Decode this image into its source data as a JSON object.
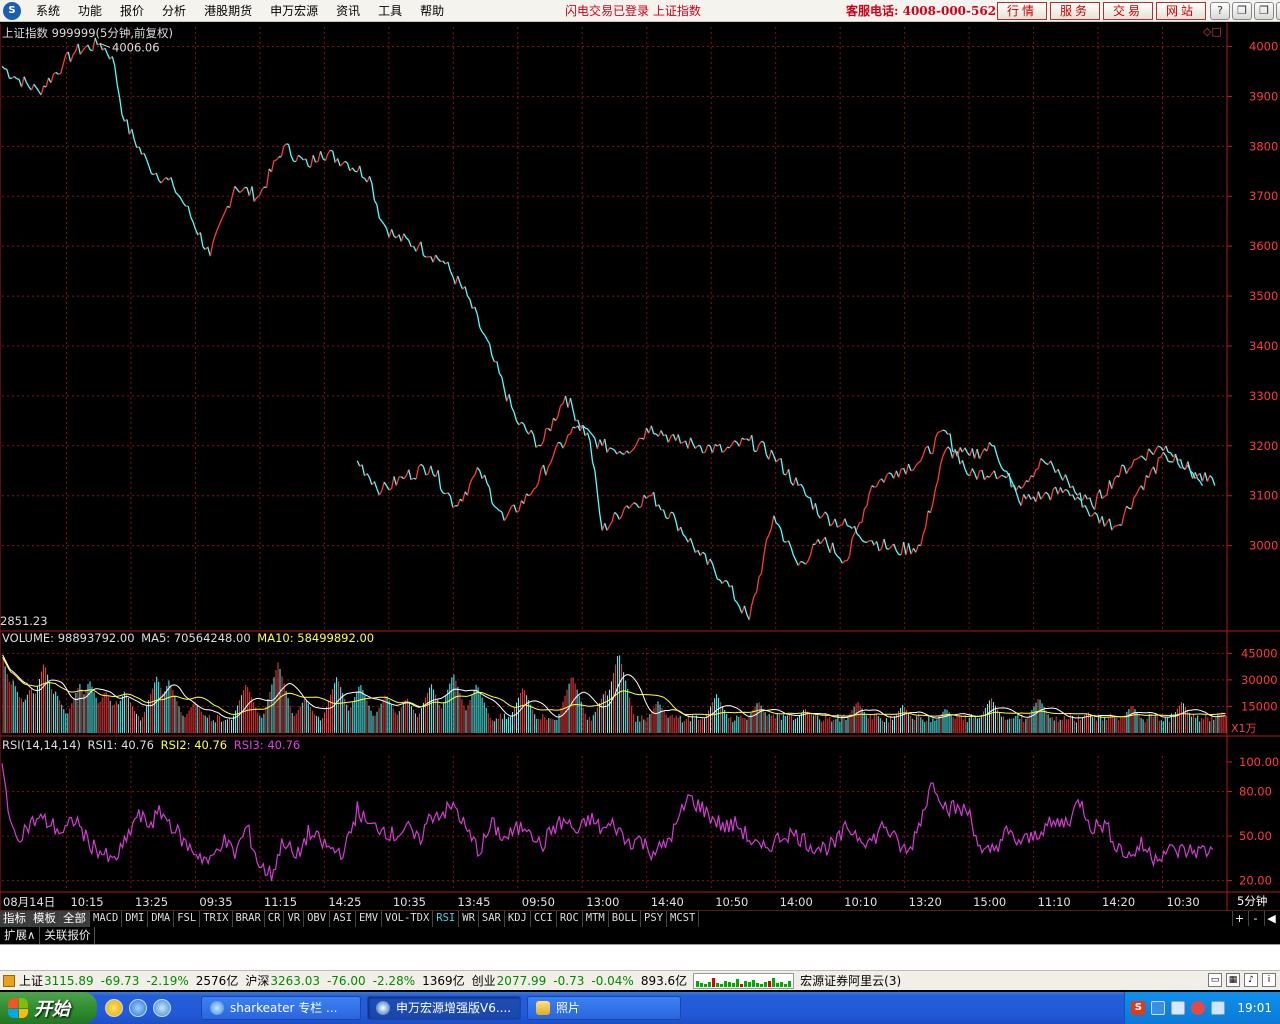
{
  "menubar": {
    "logo": "S",
    "items": [
      "系统",
      "功能",
      "报价",
      "分析",
      "港股期货",
      "申万宏源",
      "资讯",
      "工具",
      "帮助"
    ],
    "status": "闪电交易已登录   上证指数",
    "hotline": "客服电话: 4008-000-562",
    "quick_buttons": [
      "行情",
      "服务",
      "交易",
      "网站"
    ],
    "window_controls": [
      "?",
      "❐",
      "❐",
      "✕"
    ]
  },
  "price_panel": {
    "title": "上证指数 999999(5分钟,前复权)",
    "high_label": "4006.06",
    "low_label": "2851.23",
    "corner_mark": "◇□"
  },
  "volume_panel": {
    "label": "VOLUME:",
    "volume_value": "98893792.00",
    "ma5_label": "MA5:",
    "ma5_value": "70564248.00",
    "ma10_label": "MA10:",
    "ma10_value": "58499892.00",
    "unit": "X1万"
  },
  "rsi_panel": {
    "label": "RSI(14,14,14)",
    "rsi1_label": "RSI1:",
    "rsi1_value": "40.76",
    "rsi2_label": "RSI2:",
    "rsi2_value": "40.76",
    "rsi3_label": "RSI3:",
    "rsi3_value": "40.76"
  },
  "period_label": "5分钟",
  "chart_data": {
    "type": "line",
    "title": "上证指数 999999(5分钟,前复权)",
    "x_ticks": [
      "08月14日",
      "10:15",
      "13:25",
      "09:35",
      "11:15",
      "14:25",
      "10:35",
      "13:45",
      "09:50",
      "13:00",
      "14:40",
      "10:50",
      "14:00",
      "10:10",
      "13:20",
      "15:00",
      "11:10",
      "14:20",
      "10:30"
    ],
    "price": {
      "yticks": [
        3000,
        3100,
        3200,
        3300,
        3400,
        3500,
        3600,
        3700,
        3800,
        3900,
        4000
      ],
      "ylim": [
        2835,
        4015
      ],
      "high": 4006.06,
      "low": 2851.23,
      "series": [
        {
          "name": "上证指数",
          "x": [
            0,
            1,
            3,
            5,
            6,
            8,
            9,
            10,
            12,
            14,
            15,
            17,
            19,
            21,
            23,
            25,
            26,
            28,
            30,
            31,
            32,
            34,
            36,
            38,
            40,
            42,
            44,
            46,
            48,
            49,
            51,
            53,
            55,
            57,
            59,
            61,
            63,
            65,
            67,
            69,
            71,
            73,
            75,
            77,
            79,
            81,
            83,
            85,
            87,
            89,
            91,
            93,
            95,
            97,
            98
          ],
          "values": [
            3960,
            3940,
            3910,
            3965,
            3990,
            4006,
            3980,
            3850,
            3760,
            3720,
            3680,
            3580,
            3720,
            3700,
            3800,
            3760,
            3790,
            3770,
            3740,
            3650,
            3620,
            3600,
            3570,
            3500,
            3380,
            3250,
            3200,
            3300,
            3210,
            3030,
            3080,
            3100,
            3050,
            2980,
            2930,
            2851,
            3060,
            2960,
            3010,
            2970,
            3120,
            3150,
            3170,
            3230,
            3140,
            3150,
            3120,
            3170,
            3130,
            3060,
            3040,
            3120,
            3180,
            3150,
            3120
          ]
        },
        {
          "name": "",
          "x": [
            29,
            31,
            33,
            35,
            37,
            39,
            41,
            43,
            45,
            47,
            49,
            51,
            53,
            55,
            57,
            59,
            61,
            63,
            65,
            67,
            69,
            71,
            73,
            75,
            77,
            79,
            81,
            83,
            85,
            87,
            89,
            91,
            93,
            95,
            97,
            99
          ],
          "values": [
            3170,
            3110,
            3140,
            3160,
            3080,
            3150,
            3050,
            3100,
            3180,
            3240,
            3200,
            3190,
            3240,
            3210,
            3200,
            3190,
            3210,
            3180,
            3120,
            3060,
            3040,
            3010,
            2990,
            3000,
            3190,
            3180,
            3200,
            3090,
            3100,
            3110,
            3080,
            3140,
            3180,
            3200,
            3150,
            3120
          ]
        }
      ]
    },
    "volume": {
      "yticks": [
        15000,
        30000,
        45000
      ],
      "ylim": [
        0,
        48000
      ],
      "unit": "X1万",
      "spikes": [
        {
          "x": 0.05,
          "v": 42000
        },
        {
          "x": 0.85,
          "v": 30000
        },
        {
          "x": 1.5,
          "v": 20000
        },
        {
          "x": 2.3,
          "v": 26000
        },
        {
          "x": 3.4,
          "v": 40000
        },
        {
          "x": 4.3,
          "v": 24000
        },
        {
          "x": 6.3,
          "v": 28000
        },
        {
          "x": 7.1,
          "v": 30000
        },
        {
          "x": 8.4,
          "v": 24000
        },
        {
          "x": 9.3,
          "v": 18000
        },
        {
          "x": 10.0,
          "v": 24000
        },
        {
          "x": 12.6,
          "v": 32000
        },
        {
          "x": 13.6,
          "v": 30000
        },
        {
          "x": 15.7,
          "v": 18000
        },
        {
          "x": 19.9,
          "v": 28000
        },
        {
          "x": 22.5,
          "v": 40000
        },
        {
          "x": 24.7,
          "v": 20000
        },
        {
          "x": 27.3,
          "v": 32000
        },
        {
          "x": 29.2,
          "v": 28000
        },
        {
          "x": 31.3,
          "v": 22000
        },
        {
          "x": 33.0,
          "v": 20000
        },
        {
          "x": 35.0,
          "v": 28000
        },
        {
          "x": 36.8,
          "v": 34000
        },
        {
          "x": 38.7,
          "v": 28000
        },
        {
          "x": 42.5,
          "v": 26000
        },
        {
          "x": 46.5,
          "v": 33000
        },
        {
          "x": 49.2,
          "v": 24000
        },
        {
          "x": 50.3,
          "v": 46000
        },
        {
          "x": 53.5,
          "v": 18000
        },
        {
          "x": 58.3,
          "v": 22000
        },
        {
          "x": 61.7,
          "v": 18000
        },
        {
          "x": 65.5,
          "v": 14000
        },
        {
          "x": 69.8,
          "v": 18000
        },
        {
          "x": 73.5,
          "v": 16000
        },
        {
          "x": 77.0,
          "v": 14000
        },
        {
          "x": 80.7,
          "v": 20000
        },
        {
          "x": 84.6,
          "v": 20000
        },
        {
          "x": 88.6,
          "v": 12000
        },
        {
          "x": 92.2,
          "v": 16000
        },
        {
          "x": 96.3,
          "v": 18000
        },
        {
          "x": 99.5,
          "v": 12000
        }
      ]
    },
    "rsi": {
      "yticks": [
        20,
        50,
        80,
        100
      ],
      "ylim": [
        15,
        104
      ],
      "x": [
        0,
        0.5,
        1,
        2,
        3,
        4,
        5,
        6,
        7,
        8,
        9,
        10,
        11,
        12,
        13,
        14,
        15,
        16,
        17,
        18,
        19,
        20,
        21,
        22,
        23,
        24,
        25,
        26,
        27,
        28,
        29,
        30,
        31,
        32,
        33,
        34,
        35,
        36,
        37,
        38,
        39,
        40,
        41,
        42,
        43,
        44,
        45,
        46,
        47,
        48,
        49,
        50,
        51,
        52,
        53,
        54,
        55,
        56,
        57,
        58,
        59,
        60,
        61,
        62,
        63,
        64,
        65,
        66,
        67,
        68,
        69,
        70,
        71,
        72,
        73,
        74,
        75,
        76,
        77,
        78,
        79,
        80,
        81,
        82,
        83,
        84,
        85,
        86,
        87,
        88,
        89,
        90,
        91,
        92,
        93,
        94,
        95,
        96,
        97,
        98,
        99
      ],
      "values": [
        99,
        72,
        48,
        56,
        62,
        58,
        52,
        62,
        46,
        40,
        32,
        44,
        64,
        58,
        66,
        56,
        44,
        38,
        32,
        48,
        38,
        56,
        30,
        24,
        48,
        34,
        52,
        46,
        40,
        40,
        68,
        56,
        56,
        50,
        56,
        46,
        64,
        66,
        70,
        52,
        40,
        58,
        48,
        54,
        58,
        42,
        56,
        60,
        52,
        62,
        54,
        58,
        46,
        48,
        40,
        42,
        56,
        76,
        70,
        62,
        56,
        58,
        48,
        40,
        46,
        52,
        50,
        44,
        42,
        44,
        56,
        50,
        46,
        58,
        46,
        38,
        62,
        88,
        70,
        68,
        66,
        36,
        42,
        52,
        46,
        48,
        56,
        58,
        60,
        74,
        56,
        58,
        44,
        36,
        44,
        36,
        40,
        40,
        40,
        40,
        40
      ]
    }
  },
  "indicator_tabs": [
    "指标",
    "模板",
    "全部",
    "MACD",
    "DMI",
    "DMA",
    "FSL",
    "TRIX",
    "BRAR",
    "CR",
    "VR",
    "OBV",
    "ASI",
    "EMV",
    "VOL-TDX",
    "RSI",
    "WR",
    "SAR",
    "KDJ",
    "CCI",
    "ROC",
    "MTM",
    "BOLL",
    "PSY",
    "MCST"
  ],
  "tab_nav": [
    "+",
    "-",
    "◀"
  ],
  "bottom_tabs": [
    "扩展∧",
    "关联报价"
  ],
  "ticker": {
    "indices": [
      {
        "name": "上证",
        "price": "3115.89",
        "change": "-69.73",
        "pct": "-2.19%",
        "amount": "2576亿"
      },
      {
        "name": "沪深",
        "price": "3263.03",
        "change": "-76.00",
        "pct": "-2.28%",
        "amount": "1369亿"
      },
      {
        "name": "创业",
        "price": "2077.99",
        "change": "-0.73",
        "pct": "-0.04%",
        "amount": "893.6亿"
      }
    ],
    "broker": "宏源证券阿里云(3)"
  },
  "taskbar": {
    "start_label": "开始",
    "tasks": [
      "sharkeater 专栏 ...",
      "申万宏源增强版V6....",
      "照片"
    ],
    "clock": "19:01"
  },
  "colors": {
    "up": "#ff3a3a",
    "down": "#54ffff",
    "grid": "#8a1010",
    "rsi": "#d23cd2",
    "ma5": "#ffffff",
    "ma10": "#ffff40"
  }
}
